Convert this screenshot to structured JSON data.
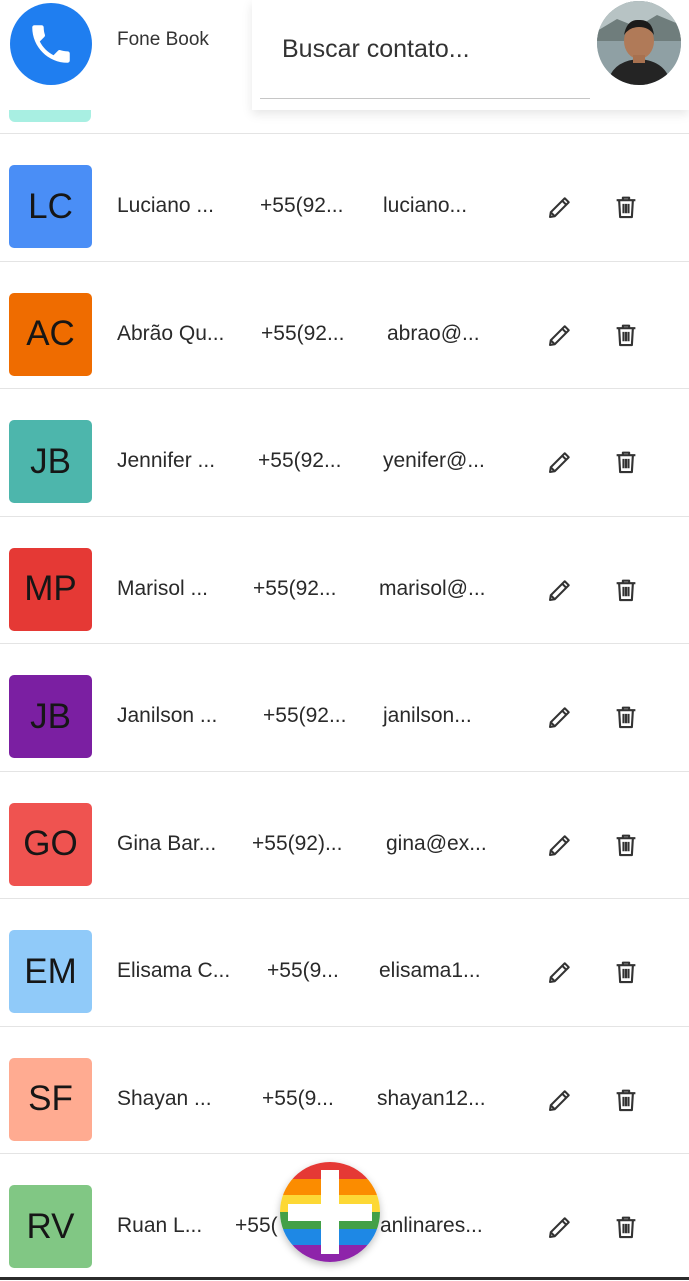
{
  "header": {
    "app_name": "Fone Book",
    "logo_icon": "phone-icon",
    "search_placeholder": "Buscar contato...",
    "search_value": "",
    "avatar_icon": "user-photo"
  },
  "contacts": [
    {
      "initials": "LC",
      "color": "#4a8ef6",
      "name": "Luciano ...",
      "phone": "+55(92...",
      "email": "luciano..."
    },
    {
      "initials": "AC",
      "color": "#ef6c00",
      "name": "Abrão Qu...",
      "phone": "+55(92...",
      "email": "abrao@..."
    },
    {
      "initials": "JB",
      "color": "#4db6ac",
      "name": "Jennifer ...",
      "phone": "+55(92...",
      "email": "yenifer@..."
    },
    {
      "initials": "MP",
      "color": "#e53935",
      "name": "Marisol ...",
      "phone": "+55(92...",
      "email": "marisol@..."
    },
    {
      "initials": "JB",
      "color": "#7b1fa2",
      "name": "Janilson ...",
      "phone": "+55(92...",
      "email": "janilson..."
    },
    {
      "initials": "GO",
      "color": "#ef5350",
      "name": "Gina Bar...",
      "phone": "+55(92)...",
      "email": "gina@ex..."
    },
    {
      "initials": "EM",
      "color": "#90caf9",
      "name": "Elisama C...",
      "phone": "+55(9...",
      "email": "elisama1..."
    },
    {
      "initials": "SF",
      "color": "#ffab91",
      "name": "Shayan ...",
      "phone": "+55(9...",
      "email": "shayan12..."
    },
    {
      "initials": "RV",
      "color": "#81c784",
      "name": "Ruan L...",
      "phone": "+55(",
      "email": "anlinares..."
    }
  ],
  "row_actions": {
    "edit_icon": "pencil-icon",
    "delete_icon": "trash-icon"
  },
  "fab": {
    "icon": "plus-icon",
    "colors": [
      "#e53935",
      "#fb8c00",
      "#fdd835",
      "#43a047",
      "#1e88e5",
      "#8e24aa"
    ]
  },
  "colors": {
    "primary": "#1f7ef0",
    "peek_chip": "#a8efe2"
  }
}
